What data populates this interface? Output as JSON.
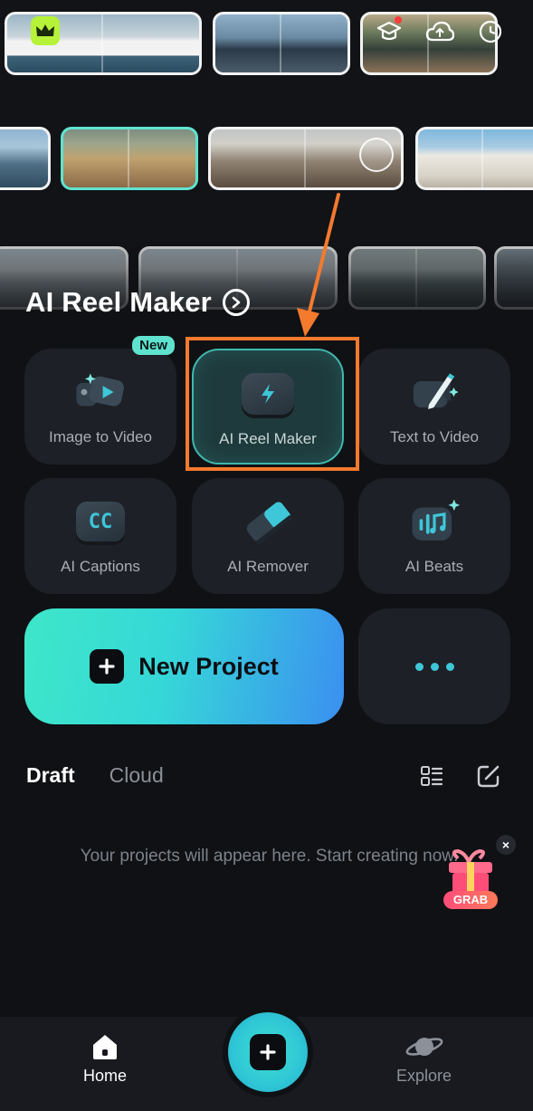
{
  "hero": {
    "section_title": "AI Reel Maker",
    "thumbnails": [
      "ship",
      "city",
      "market",
      "tower",
      "beach",
      "bridge",
      "houses",
      "harbor",
      "sea",
      "pier"
    ]
  },
  "header_icons": [
    "crown-icon",
    "graduation-cap-icon",
    "cloud-icon",
    "clock-icon"
  ],
  "tools": [
    {
      "label": "Image to Video",
      "icon": "image-video-icon",
      "badge": "New"
    },
    {
      "label": "AI Reel Maker",
      "icon": "lightning-icon"
    },
    {
      "label": "Text to Video",
      "icon": "pencil-video-icon"
    },
    {
      "label": "AI Captions",
      "icon": "cc-icon",
      "icon_text": "CC"
    },
    {
      "label": "AI Remover",
      "icon": "eraser-icon"
    },
    {
      "label": "AI Beats",
      "icon": "music-beats-icon"
    }
  ],
  "new_project": {
    "label": "New Project"
  },
  "tabs": {
    "draft": "Draft",
    "cloud": "Cloud"
  },
  "empty_state": "Your projects will appear here. Start creating now.",
  "promo": {
    "label": "GRAB",
    "close": "×"
  },
  "bottom_nav": {
    "home": "Home",
    "explore": "Explore"
  },
  "colors": {
    "accent": "#3ee0d0",
    "highlight": "#f47a2e",
    "background": "#0f1114",
    "card": "#1d2026"
  }
}
